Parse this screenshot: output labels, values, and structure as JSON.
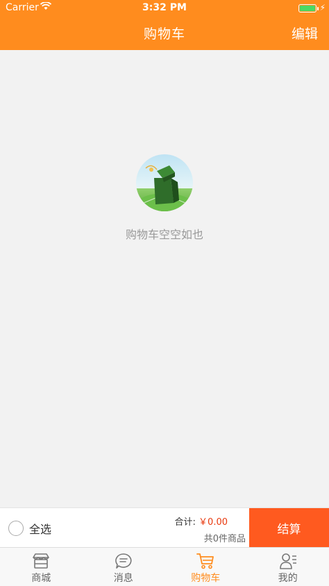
{
  "status_bar": {
    "carrier": "Carrier",
    "time": "3:32 PM"
  },
  "header": {
    "title": "购物车",
    "edit_label": "编辑"
  },
  "empty_state": {
    "message": "购物车空空如也"
  },
  "cart_footer": {
    "select_all_label": "全选",
    "total_label": "合计:",
    "total_amount": "￥0.00",
    "count_text": "共0件商品",
    "checkout_label": "结算"
  },
  "tabs": [
    {
      "label": "商城",
      "icon": "store-icon"
    },
    {
      "label": "消息",
      "icon": "message-icon"
    },
    {
      "label": "购物车",
      "icon": "cart-icon",
      "active": true
    },
    {
      "label": "我的",
      "icon": "profile-icon"
    }
  ],
  "colors": {
    "primary": "#ff8c1e",
    "checkout": "#ff5a1f",
    "price": "#e8380d",
    "background": "#f2f2f2"
  }
}
